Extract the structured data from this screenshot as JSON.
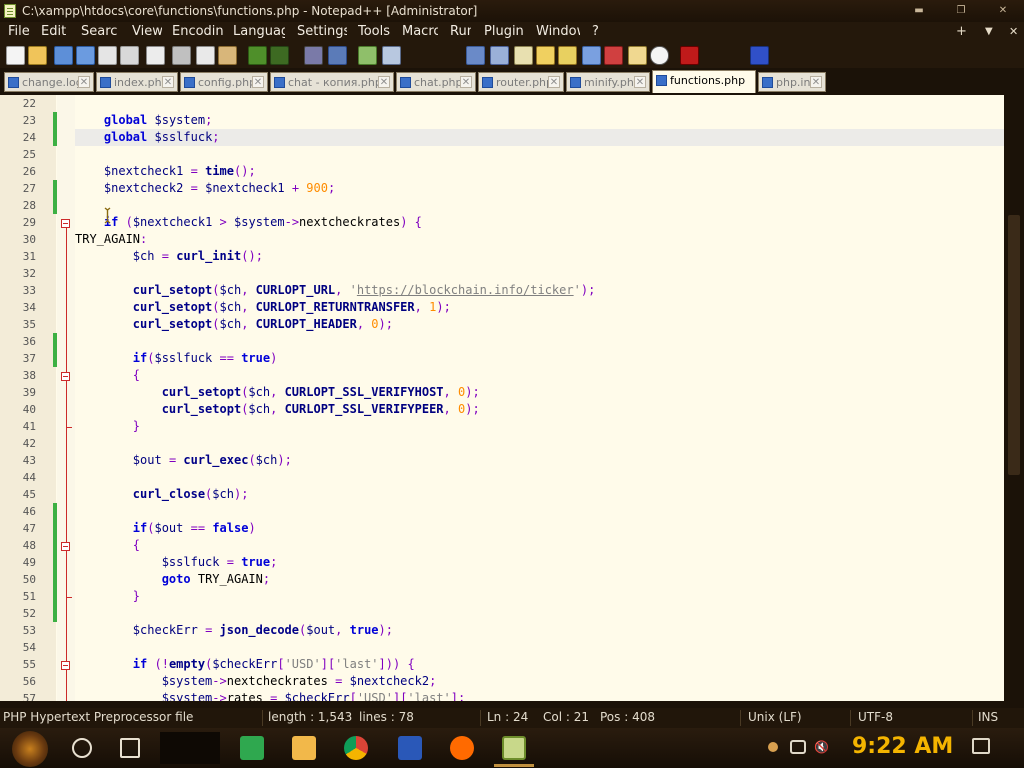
{
  "window": {
    "title": "C:\\xampp\\htdocs\\core\\functions\\functions.php - Notepad++ [Administrator]",
    "buttons": [
      "▬",
      "❐",
      "✕"
    ]
  },
  "menu": {
    "items": [
      "File",
      "Edit",
      "Search",
      "View",
      "Encoding",
      "Language",
      "Settings",
      "Tools",
      "Macro",
      "Run",
      "Plugins",
      "Window",
      "?"
    ],
    "right": [
      "+",
      "▼",
      "✕"
    ]
  },
  "tabs": [
    {
      "label": "change.log",
      "active": false
    },
    {
      "label": "index.php",
      "active": false
    },
    {
      "label": "config.php",
      "active": false
    },
    {
      "label": "chat - копия.php",
      "active": false
    },
    {
      "label": "chat.php",
      "active": false
    },
    {
      "label": "router.php",
      "active": false
    },
    {
      "label": "minify.php",
      "active": false
    },
    {
      "label": "functions.php",
      "active": true
    },
    {
      "label": "php.ini",
      "active": false
    }
  ],
  "editor": {
    "line_numbers": [
      "22",
      "23",
      "24",
      "25",
      "26",
      "27",
      "28",
      "29",
      "30",
      "31",
      "32",
      "33",
      "34",
      "35",
      "36",
      "37",
      "38",
      "39",
      "40",
      "41",
      "42",
      "43",
      "44",
      "45",
      "46",
      "47",
      "48",
      "49",
      "50",
      "51",
      "52",
      "53",
      "54",
      "55",
      "56",
      "57"
    ],
    "current_line": "24",
    "code": [
      "",
      "    global $system;",
      "    global $sslfuck;",
      "",
      "    $nextcheck1 = time();",
      "    $nextcheck2 = $nextcheck1 + 900;",
      "",
      "    if ($nextcheck1 > $system->nextcheckrates) {",
      "TRY_AGAIN:",
      "        $ch = curl_init();",
      "",
      "        curl_setopt($ch, CURLOPT_URL, 'https://blockchain.info/ticker');",
      "        curl_setopt($ch, CURLOPT_RETURNTRANSFER, 1);",
      "        curl_setopt($ch, CURLOPT_HEADER, 0);",
      "",
      "        if($sslfuck == true)",
      "        {",
      "            curl_setopt($ch, CURLOPT_SSL_VERIFYHOST, 0);",
      "            curl_setopt($ch, CURLOPT_SSL_VERIFYPEER, 0);",
      "        }",
      "",
      "        $out = curl_exec($ch);",
      "",
      "        curl_close($ch);",
      "",
      "        if($out == false)",
      "        {",
      "            $sslfuck = true;",
      "            goto TRY_AGAIN;",
      "        }",
      "",
      "        $checkErr = json_decode($out, true);",
      "",
      "        if (!empty($checkErr['USD']['last'])) {",
      "            $system->nextcheckrates = $nextcheck2;",
      "            $system->rates = $checkErr['USD']['last'];"
    ]
  },
  "status": {
    "file_type": "PHP Hypertext Preprocessor file",
    "length": "length : 1,543",
    "lines": "lines : 78",
    "ln": "Ln : 24",
    "col": "Col : 21",
    "pos": "Pos : 408",
    "eol": "Unix (LF)",
    "encoding": "UTF-8",
    "mode": "INS"
  },
  "taskbar": {
    "clock": "9:22 AM"
  }
}
